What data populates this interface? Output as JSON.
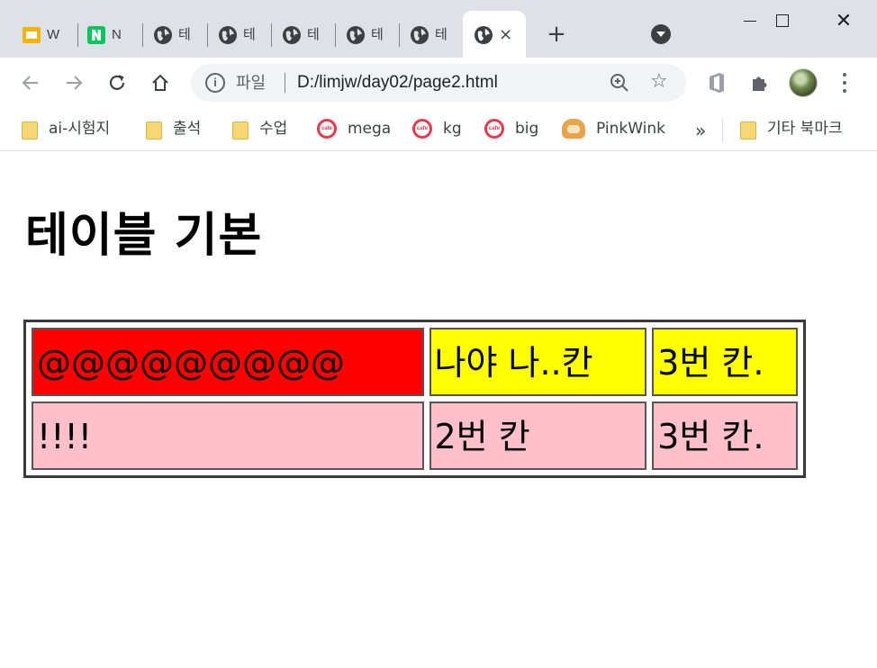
{
  "browser": {
    "tabs": [
      {
        "label": "W",
        "icon": "google-slides-icon"
      },
      {
        "label": "N",
        "icon": "naver-icon"
      },
      {
        "label": "테",
        "icon": "globe-icon"
      },
      {
        "label": "테",
        "icon": "globe-icon"
      },
      {
        "label": "테",
        "icon": "globe-icon"
      },
      {
        "label": "테",
        "icon": "globe-icon"
      },
      {
        "label": "테",
        "icon": "globe-icon"
      },
      {
        "label": "",
        "icon": "globe-icon",
        "active": true
      }
    ],
    "active_tab_close": "×",
    "new_tab": "+",
    "window_close": "✕",
    "address": {
      "scheme_label": "파일",
      "url": "D:/limjw/day02/page2.html"
    },
    "bookmarks": [
      {
        "label": "ai-시험지",
        "icon": "folder-icon"
      },
      {
        "label": "출석",
        "icon": "folder-icon"
      },
      {
        "label": "수업",
        "icon": "folder-icon"
      },
      {
        "label": "mega",
        "icon": "cafe-icon"
      },
      {
        "label": "kg",
        "icon": "cafe-icon"
      },
      {
        "label": "big",
        "icon": "cafe-icon"
      },
      {
        "label": "PinkWink",
        "icon": "pinkwink-icon"
      }
    ],
    "cafe_badge": "cafe",
    "bookmarks_more": "»",
    "other_bookmarks": "기타 북마크"
  },
  "page": {
    "title": "테이블 기본",
    "table": {
      "rows": [
        {
          "cells": [
            {
              "text": "@@@@@@@@@",
              "color": "#ff0000"
            },
            {
              "text": "나야 나..칸",
              "color": "#ffff00"
            },
            {
              "text": "3번 칸.",
              "color": "#ffff00"
            }
          ]
        },
        {
          "cells": [
            {
              "text": "!!!!",
              "color": "#ffc0cb"
            },
            {
              "text": "2번 칸",
              "color": "#ffc0cb"
            },
            {
              "text": "3번 칸.",
              "color": "#ffc0cb"
            }
          ]
        }
      ]
    }
  }
}
